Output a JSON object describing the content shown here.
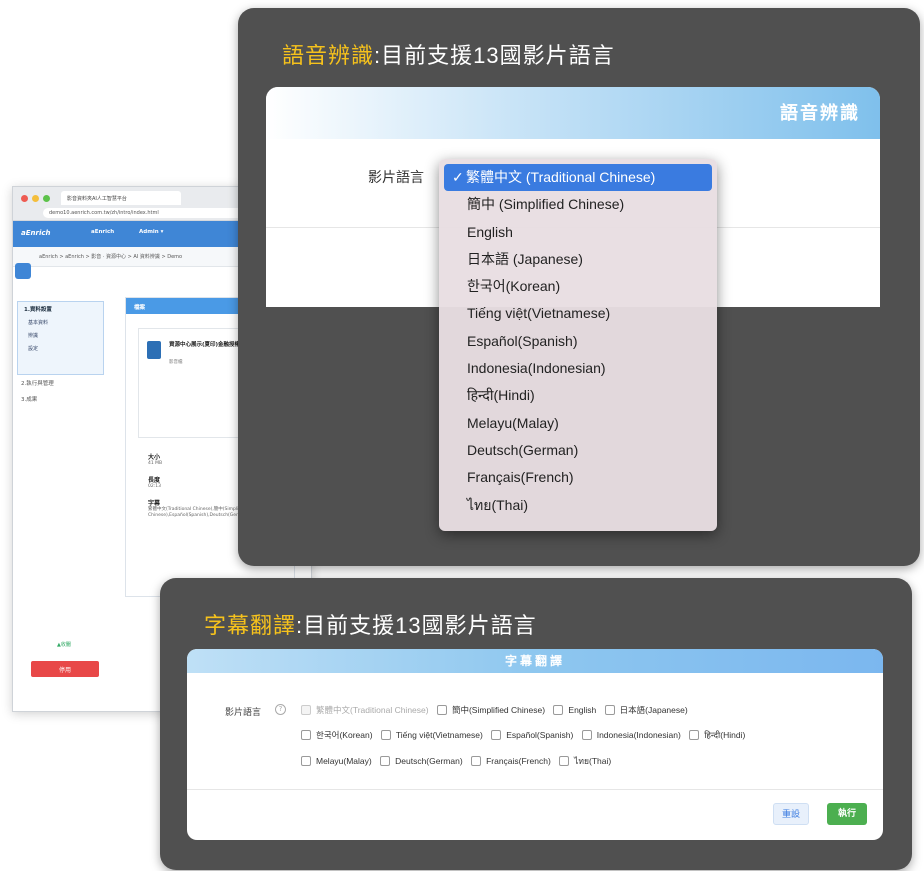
{
  "browser": {
    "tab_title": "影音資料夾AI人工智慧平台",
    "url": "demo10.aenrich.com.tw/zh/intro/index.html",
    "brand": "aEnrich",
    "nav_item_1": "aEnrich",
    "nav_item_2": "Admin ▾",
    "breadcrumb": "aEnrich  >  aEnrich  >  影音 · 資源中心  >  AI 資料辨識  >  Demo",
    "sidebar": {
      "step1": "1.資料設置",
      "sub1": "基本資料",
      "sub2": "辨識",
      "sub3": "設定",
      "step2": "2.執行與管理",
      "step3": "3.成果",
      "collapse": "▲收闔",
      "stop": "停用"
    },
    "card": {
      "header": "檔案",
      "file_name": "資源中心展示(夏印)金融授權資訊先.mp4",
      "file_sub": "影音檔",
      "size_label": "大小",
      "size_value": "41 MB",
      "length_label": "長度",
      "length_value": "02:13",
      "subtitle_label": "字幕",
      "subtitle_value": "繁體中文(Traditional Chinese),簡中(Simplified Chinese),Español(Spanish),Deutsch(German)"
    }
  },
  "speech_panel": {
    "title_highlight": "語音辨識",
    "title_rest": ":目前支援13國影片語言",
    "dialog_header": "語音辨識",
    "field_label": "影片語言",
    "options": [
      "繁體中文 (Traditional Chinese)",
      "簡中 (Simplified Chinese)",
      "English",
      "日本語 (Japanese)",
      "한국어(Korean)",
      "Tiếng việt(Vietnamese)",
      "Español(Spanish)",
      "Indonesia(Indonesian)",
      "हिन्दी(Hindi)",
      "Melayu(Malay)",
      "Deutsch(German)",
      "Français(French)",
      "ไทย(Thai)"
    ],
    "selected_check": "✓"
  },
  "subtitle_panel": {
    "title_highlight": "字幕翻譯",
    "title_rest": ":目前支援13國影片語言",
    "dialog_header": "字幕翻譯",
    "field_label": "影片語言",
    "info": "?",
    "row1": [
      "繁體中文(Traditional Chinese)",
      "簡中(Simplified Chinese)",
      "English",
      "日本語(Japanese)"
    ],
    "row2": [
      "한국어(Korean)",
      "Tiếng việt(Vietnamese)",
      "Español(Spanish)",
      "Indonesia(Indonesian)",
      "हिन्दी(Hindi)"
    ],
    "row3": [
      "Melayu(Malay)",
      "Deutsch(German)",
      "Français(French)",
      "ไทย(Thai)"
    ],
    "reset_label": "重設",
    "run_label": "執行"
  },
  "colors": {
    "highlight": "#f6c21c",
    "panel": "#505050",
    "selected": "#3a7be0",
    "run": "#4caf50",
    "stop": "#e84848"
  }
}
